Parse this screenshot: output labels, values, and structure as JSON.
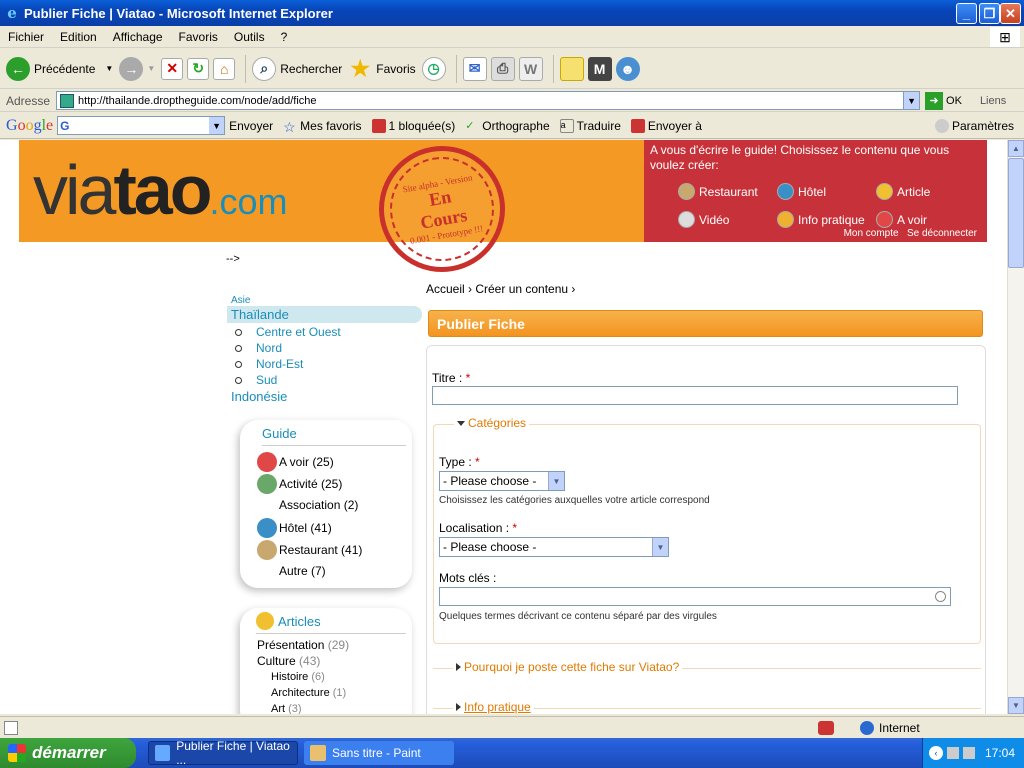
{
  "window": {
    "title": "Publier Fiche | Viatao - Microsoft Internet Explorer"
  },
  "menu": [
    "Fichier",
    "Edition",
    "Affichage",
    "Favoris",
    "Outils",
    "?"
  ],
  "toolbar": {
    "back": "Précédente",
    "search": "Rechercher",
    "favorites": "Favoris"
  },
  "address": {
    "label": "Adresse",
    "url": "http://thailande.droptheguide.com/node/add/fiche",
    "go": "OK",
    "links": "Liens"
  },
  "google": {
    "logo": "Google",
    "search_prefix": "G",
    "send": "Envoyer",
    "favorites": "Mes favoris",
    "blocked": "1 bloquée(s)",
    "spell": "Orthographe",
    "translate": "Traduire",
    "send_to": "Envoyer à",
    "settings": "Paramètres"
  },
  "header": {
    "logo_via": "via",
    "logo_tao": "tao",
    "logo_com": ".com",
    "stamp_top": "Site alpha - Version",
    "stamp_main1": "En",
    "stamp_main2": "Cours",
    "stamp_bottom": "0.001 - Prototype !!!",
    "promo_text": "A vous d'écrire le guide! Choisissez le contenu que vous voulez créer:",
    "links": [
      "Restaurant",
      "Hôtel",
      "Article",
      "Vidéo",
      "Info pratique",
      "A voir"
    ],
    "account": "Mon compte",
    "logout": "Se déconnecter"
  },
  "arrow": "-->",
  "sidebar": {
    "asie": "Asie",
    "thailande": "Thaïlande",
    "regions": [
      "Centre et Ouest",
      "Nord",
      "Nord-Est",
      "Sud"
    ],
    "indonesie": "Indonésie"
  },
  "guide": {
    "title": "Guide",
    "items": [
      {
        "label": "A voir (25)"
      },
      {
        "label": "Activité (25)"
      },
      {
        "label": "Association (2)"
      },
      {
        "label": "Hôtel (41)"
      },
      {
        "label": "Restaurant (41)"
      },
      {
        "label": "Autre (7)"
      }
    ]
  },
  "articles": {
    "title": "Articles",
    "items": [
      {
        "label": "Présentation",
        "count": "(29)"
      },
      {
        "label": "Culture",
        "count": "(43)"
      },
      {
        "label": "Histoire",
        "count": "(6)"
      },
      {
        "label": "Architecture",
        "count": "(1)"
      },
      {
        "label": "Art",
        "count": "(3)"
      }
    ]
  },
  "breadcrumb": "Accueil › Créer un contenu ›",
  "page_title": "Publier Fiche",
  "form": {
    "titre_label": "Titre :",
    "required": "*",
    "categories": "Catégories",
    "type_label": "Type :",
    "type_value": "- Please choose -",
    "type_help": "Choisissez les catégories auxquelles votre article correspond",
    "loc_label": "Localisation :",
    "loc_value": "- Please choose -",
    "tags_label": "Mots clés :",
    "tags_help": "Quelques termes décrivant ce contenu séparé par des virgules",
    "why": "Pourquoi je poste cette fiche sur Viatao?",
    "info": "Info pratique"
  },
  "status": {
    "zone": "Internet"
  },
  "taskbar": {
    "start": "démarrer",
    "tasks": [
      "Publier Fiche | Viatao ...",
      "Sans titre - Paint"
    ],
    "clock": "17:04"
  }
}
